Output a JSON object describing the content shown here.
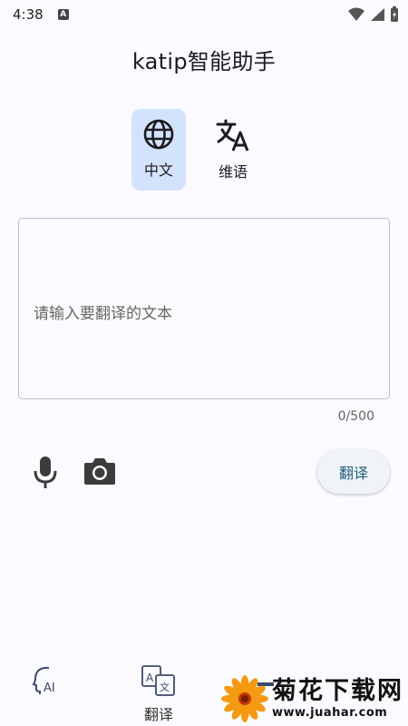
{
  "status_bar": {
    "time": "4:38",
    "badge": "A"
  },
  "header": {
    "title": "katip智能助手"
  },
  "language_switch": {
    "options": [
      {
        "label": "中文",
        "icon": "globe-icon",
        "active": true
      },
      {
        "label": "维语",
        "icon": "translate-icon",
        "active": false
      }
    ]
  },
  "input": {
    "placeholder": "请输入要翻译的文本",
    "value": "",
    "counter": "0/500"
  },
  "actions": {
    "translate_label": "翻译",
    "mic_icon": "microphone-icon",
    "camera_icon": "camera-icon"
  },
  "bottom_nav": {
    "items": [
      {
        "label": "",
        "icon": "ai-assistant-icon"
      },
      {
        "label": "翻译",
        "icon": "translate-nav-icon"
      },
      {
        "label": "",
        "icon": "document-icon"
      },
      {
        "label": "",
        "icon": "profile-icon"
      }
    ]
  },
  "watermark": {
    "name": "菊花下载网",
    "url": "www.juahar.com"
  },
  "colors": {
    "accent_bg": "#d3e3fd",
    "button_text": "#1f5f7a",
    "background": "#fbfafe"
  }
}
